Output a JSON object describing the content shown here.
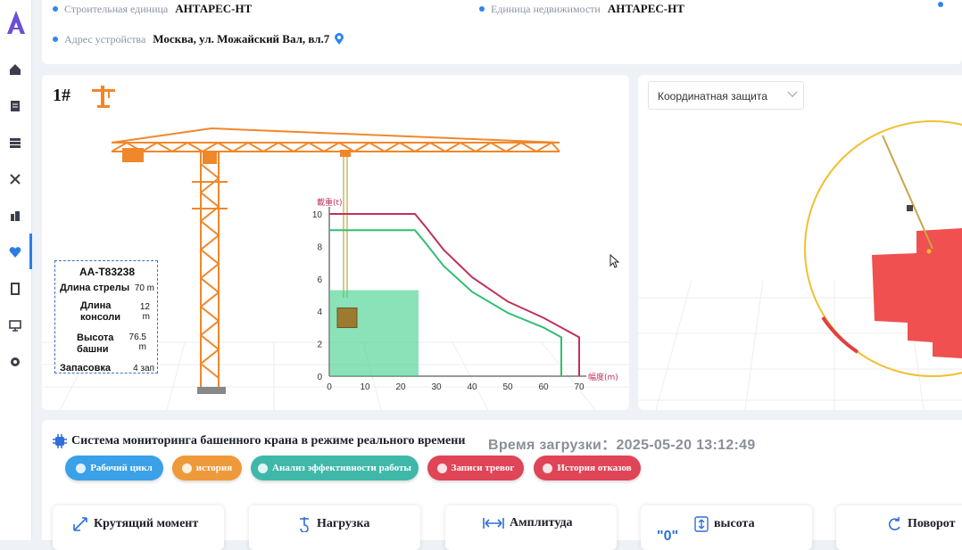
{
  "header": {
    "building_unit_label": "Строительная единица",
    "building_unit_value": "АНТАРЕС-НТ",
    "property_unit_label": "Единица недвижимости",
    "property_unit_value": "АНТАРЕС-НТ",
    "address_label": "Адрес устройства",
    "address_value": "Москва, ул. Можайский Вал, вл.7"
  },
  "crane": {
    "number": "1#",
    "info": {
      "model": "AA-T83238",
      "boom_length_label": "Длина стрелы",
      "boom_length_value": "70 m",
      "console_length_label_1": "Длина",
      "console_length_label_2": "консоли",
      "console_length_value_1": "12",
      "console_length_value_2": "m",
      "tower_height_label_1": "Высота",
      "tower_height_label_2": "башни",
      "tower_height_value_1": "76.5",
      "tower_height_value_2": "m",
      "reeving_label": "Запасовка",
      "reeving_value": "4 зап"
    }
  },
  "chart_data": {
    "type": "line",
    "ylabel": "載重(t)",
    "xlabel": "幅度(m)",
    "xlim": [
      0,
      70
    ],
    "ylim": [
      0,
      10
    ],
    "x_ticks": [
      "0",
      "10",
      "20",
      "30",
      "40",
      "50",
      "60",
      "70"
    ],
    "y_ticks": [
      "0",
      "2",
      "4",
      "6",
      "8",
      "10"
    ],
    "series": [
      {
        "color": "#c0325a",
        "x": [
          0,
          24,
          27,
          32,
          40,
          50,
          60,
          70,
          70
        ],
        "y": [
          10,
          10,
          9.2,
          7.8,
          6.1,
          4.6,
          3.6,
          2.4,
          0
        ]
      },
      {
        "color": "#2fbf71",
        "x": [
          0,
          24,
          27,
          32,
          40,
          50,
          60,
          65,
          65
        ],
        "y": [
          9,
          9,
          8.2,
          6.8,
          5.2,
          3.9,
          3.0,
          2.4,
          0
        ]
      }
    ],
    "current_load_region": {
      "x": [
        0,
        25
      ],
      "y": [
        0,
        5.3
      ]
    },
    "hook_position": {
      "x": 5,
      "y": 3.6
    }
  },
  "protection": {
    "select_value": "Координатная защита"
  },
  "monitoring": {
    "title": "Система мониторинга башенного крана в режиме реального времени",
    "load_time": "Время загрузки：2025-05-20 13:12:49",
    "buttons": [
      {
        "label": "Рабочий цикл",
        "color": "#3aa0e8"
      },
      {
        "label": "история",
        "color": "#ee9a3a"
      },
      {
        "label": "Анализ эффективности работы",
        "color": "#3fb8aa"
      },
      {
        "label": "Записи тревог",
        "color": "#e04457"
      },
      {
        "label": "История отказов",
        "color": "#e04457"
      }
    ],
    "cards": [
      {
        "title": "Крутящий момент"
      },
      {
        "title": "Нагрузка"
      },
      {
        "title": "Амплитуда"
      },
      {
        "title": "высота",
        "value": "\"0\""
      },
      {
        "title": "Поворот"
      }
    ]
  },
  "colors": {
    "accent": "#2e86f0",
    "crane_orange": "#f0872b",
    "protect_zone_red": "#f05050",
    "protect_circle": "#f0c030"
  }
}
